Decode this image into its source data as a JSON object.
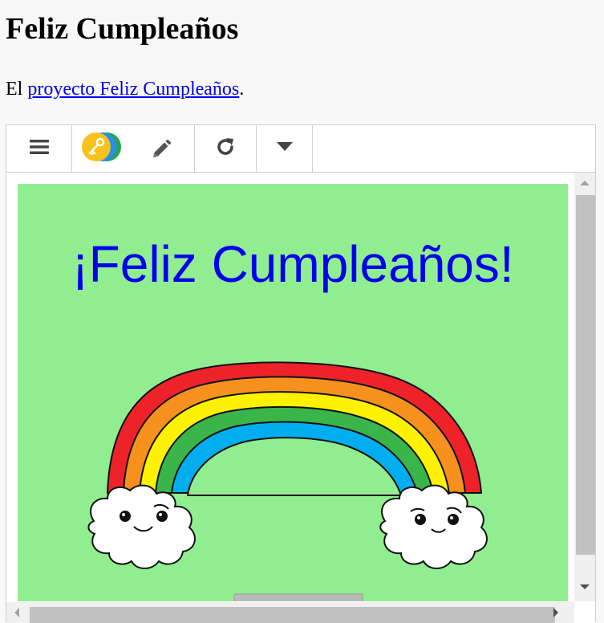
{
  "page": {
    "title": "Feliz Cumpleaños",
    "intro_prefix": "El ",
    "intro_link": "proyecto Feliz Cumpleaños",
    "intro_suffix": "."
  },
  "toolbar": {
    "menu_icon": "hamburger-menu-icon",
    "key_icon": "key-toggle-icon",
    "edit_icon": "pencil-icon",
    "reload_icon": "refresh-icon",
    "more_icon": "caret-down-icon"
  },
  "stage": {
    "background": "#90ee90",
    "heading": "¡Feliz Cumpleaños!",
    "heading_color": "#0000ee",
    "rainbow_colors": [
      "#ee2229",
      "#f6911e",
      "#fff200",
      "#39b54a",
      "#00aeef"
    ]
  }
}
